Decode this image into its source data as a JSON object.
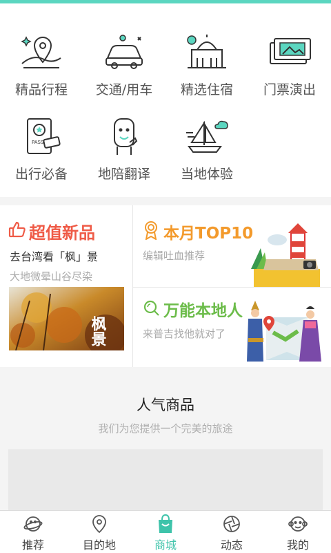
{
  "categories": [
    {
      "label": "精品行程",
      "icon": "map-pin-icon"
    },
    {
      "label": "交通/用车",
      "icon": "car-icon"
    },
    {
      "label": "精选住宿",
      "icon": "hotel-icon"
    },
    {
      "label": "门票演出",
      "icon": "ticket-icon"
    },
    {
      "label": "出行必备",
      "icon": "passport-icon"
    },
    {
      "label": "地陪翻译",
      "icon": "guide-icon"
    },
    {
      "label": "当地体验",
      "icon": "sailboat-icon"
    }
  ],
  "promo": {
    "left": {
      "title": "超值新品",
      "subtitle": "去台湾看「枫」景",
      "desc": "大地微晕山谷尽染",
      "image_caption": "枫景"
    },
    "top10": {
      "title": "本月TOP10",
      "desc": "编辑吐血推荐"
    },
    "local": {
      "title": "万能本地人",
      "desc": "来普吉找他就对了"
    }
  },
  "popular": {
    "title": "人气商品",
    "subtitle": "我们为您提供一个完美的旅途"
  },
  "tabs": [
    {
      "label": "推荐",
      "icon": "planet-icon",
      "active": false
    },
    {
      "label": "目的地",
      "icon": "location-icon",
      "active": false
    },
    {
      "label": "商城",
      "icon": "shopping-bag-icon",
      "active": true
    },
    {
      "label": "动态",
      "icon": "aperture-icon",
      "active": false
    },
    {
      "label": "我的",
      "icon": "monkey-icon",
      "active": false
    }
  ],
  "colors": {
    "accent": "#3ec3aa",
    "top_bar": "#5bd6c0",
    "promo_red": "#ef5b47",
    "promo_orange": "#f39a2c",
    "promo_green": "#6cbc4a"
  }
}
